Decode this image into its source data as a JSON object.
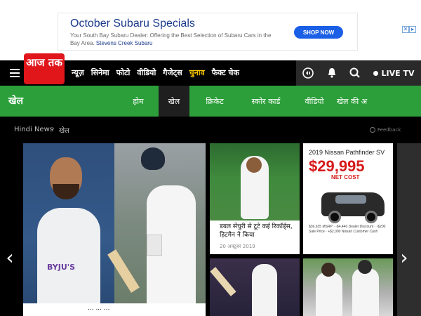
{
  "ad": {
    "title": "October Subaru Specials",
    "description_line1": "Your South Bay Subaru Dealer: Offering the Best Selection of Subaru Cars in the",
    "description_line2_prefix": "Bay Area.",
    "advertiser": "Stevens Creek Subaru",
    "cta": "SHOP NOW"
  },
  "logo": {
    "text": "आज तक"
  },
  "nav": {
    "items": [
      "न्यूज़",
      "सिनेमा",
      "फोटो",
      "वीडियो",
      "गैजेट्स",
      "चुनाव",
      "फैक्ट चेक"
    ],
    "active_item": "चुनाव",
    "live_tv": "LIVE TV",
    "icons": [
      "menu-icon",
      "audio-icon",
      "notification-icon",
      "search-icon"
    ]
  },
  "section": {
    "title": "खेल",
    "tabs": [
      "होम",
      "खेल",
      "क्रिकेट",
      "स्कोर कार्ड",
      "वीडियो",
      "खेल की अ"
    ],
    "active_tab": "खेल"
  },
  "breadcrumb": {
    "home": "Hindi News",
    "separator": "›",
    "current": "खेल",
    "feedback": "Feedback"
  },
  "carousel": {
    "lead": {
      "jersey_text": "BYJU'S",
      "caption": "... ... ..."
    },
    "card1": {
      "title": "डबल सेंचुरी से टूटे कई रिकॉर्ड्स, हिटमैन ने किया",
      "date": "20 अक्टूबर 2019"
    },
    "ad_card": {
      "title": "2019 Nissan Pathfinder SV",
      "price": "$29,995",
      "net": "NET COST",
      "fine_print": "$36,635 MSRP · -$4,440 Dealer Discount · -$200 Sale Price · +$2,000 Nissan Customer Cash"
    }
  },
  "colors": {
    "brand_red": "#e0161b",
    "section_green": "#2c9f3a",
    "active_nav": "#f7c600",
    "ad_button": "#1a5fe6"
  }
}
